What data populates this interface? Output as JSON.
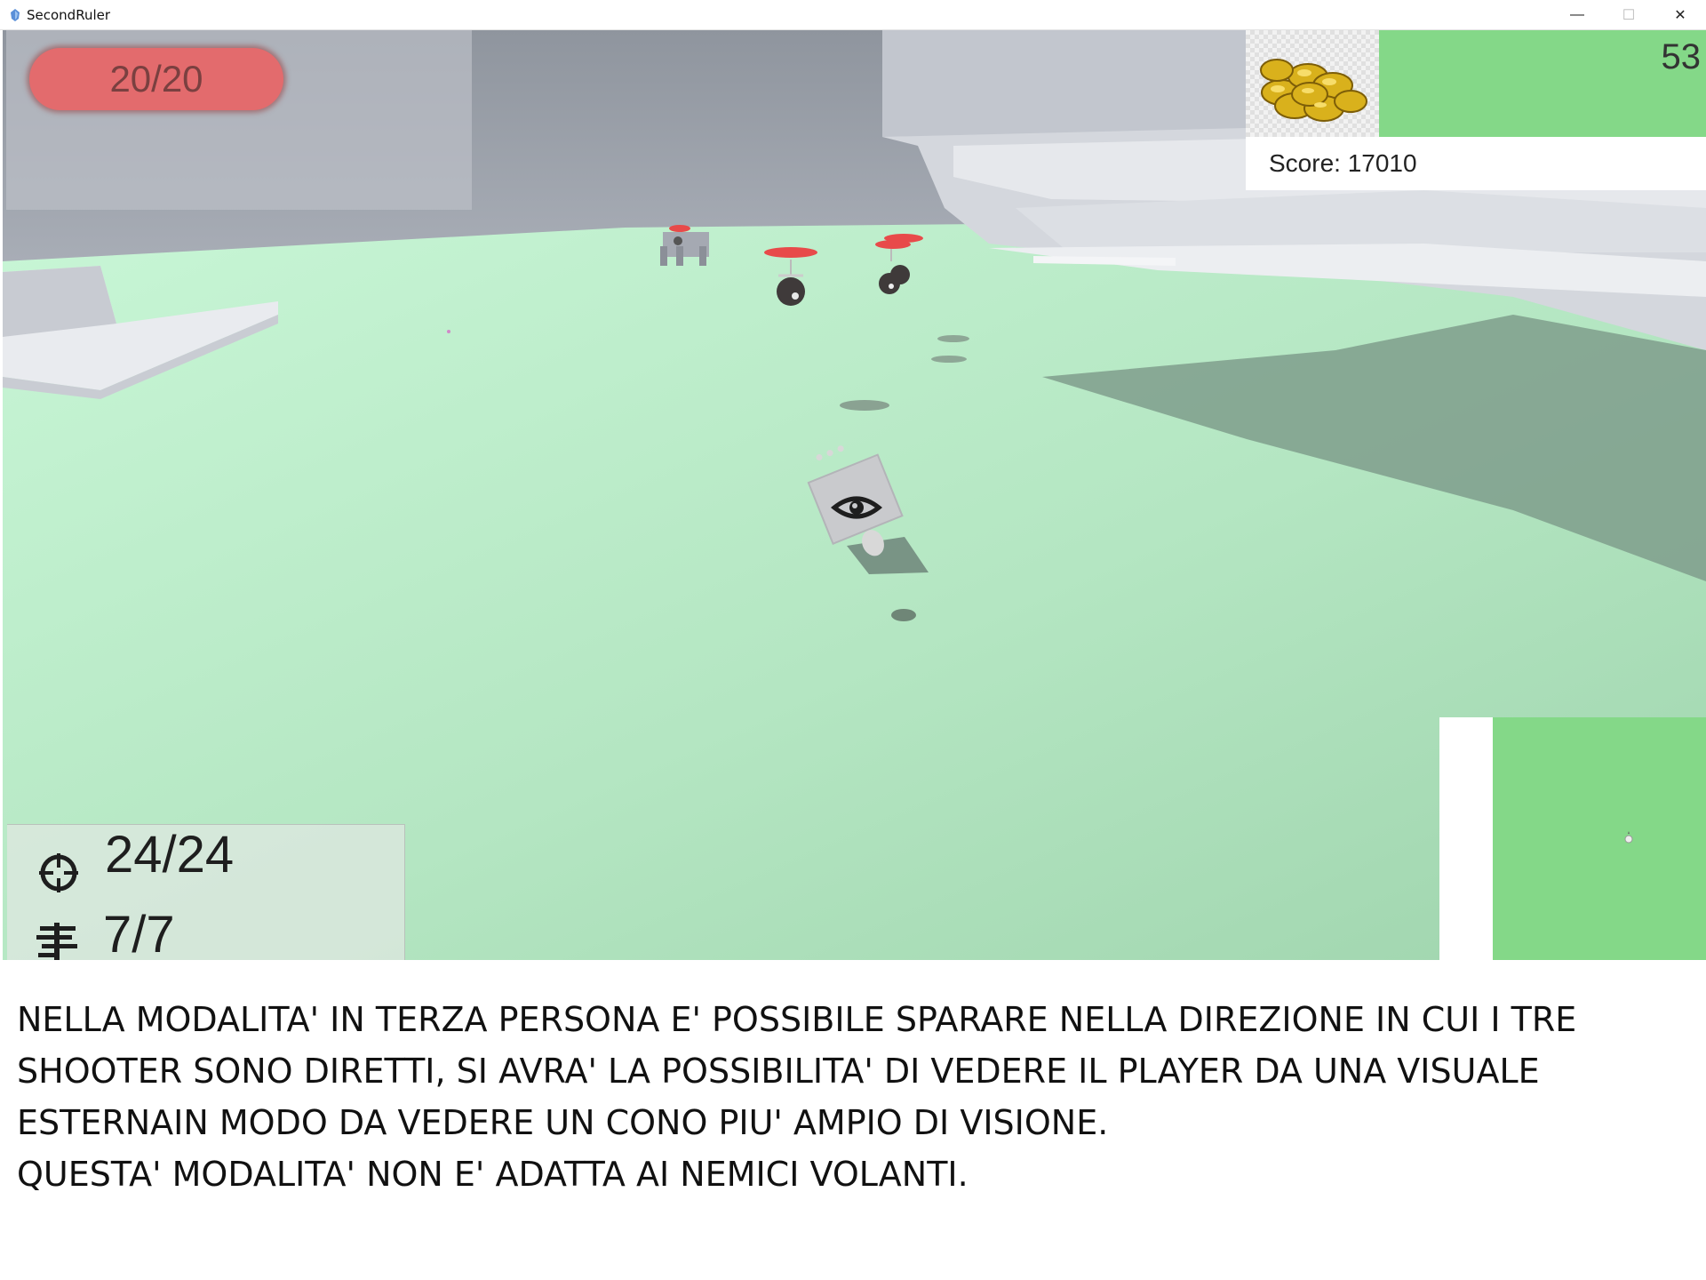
{
  "window": {
    "title": "SecondRuler",
    "minimize_glyph": "—",
    "maximize_glyph": "☐",
    "close_glyph": "✕"
  },
  "hud": {
    "health": "20/20",
    "timer": "53",
    "score": "Score: 17010",
    "ammo": "24/24",
    "grenades": "7/7",
    "icons": {
      "coins": "gold-coins-icon",
      "ammo": "crosshair-icon",
      "grenades": "grenade-rack-icon",
      "player": "eye-icon"
    },
    "colors": {
      "health_bar": "#e36b6d",
      "timer_bg": "#84d888",
      "ground": "#c4f0d4",
      "enemy_marker": "#e84a4a"
    }
  },
  "caption": {
    "lines": [
      "NELLA MODALITA' IN TERZA PERSONA E' POSSIBILE SPARARE NELLA DIREZIONE IN CUI I TRE",
      "SHOOTER SONO DIRETTI, SI AVRA' LA POSSIBILITA' DI VEDERE IL PLAYER DA UNA VISUALE",
      "ESTERNAIN MODO DA VEDERE UN CONO PIU' AMPIO DI VISIONE.",
      "QUESTA' MODALITA' NON E' ADATTA AI NEMICI VOLANTI."
    ]
  }
}
